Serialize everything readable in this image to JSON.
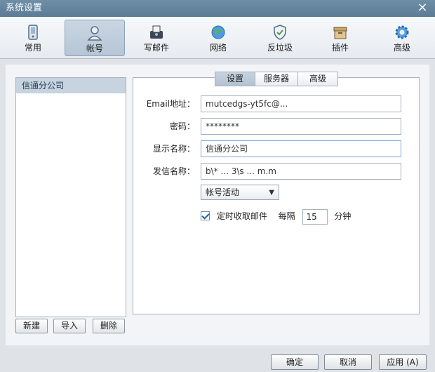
{
  "window": {
    "title": "系统设置",
    "close_icon": "close-icon"
  },
  "toolbar": {
    "items": [
      {
        "label": "常用",
        "icon": "phone-icon"
      },
      {
        "label": "帐号",
        "icon": "user-icon"
      },
      {
        "label": "写邮件",
        "icon": "compose-icon"
      },
      {
        "label": "网络",
        "icon": "globe-icon"
      },
      {
        "label": "反垃圾",
        "icon": "shield-icon"
      },
      {
        "label": "插件",
        "icon": "box-icon"
      },
      {
        "label": "高级",
        "icon": "gear-icon"
      }
    ],
    "active_index": 1
  },
  "accounts": {
    "items": [
      "信通分公司"
    ],
    "selected": "信通分公司"
  },
  "left_buttons": {
    "new": "新建",
    "import": "导入",
    "delete": "删除"
  },
  "tabs": [
    {
      "label": "设置"
    },
    {
      "label": "服务器"
    },
    {
      "label": "高级"
    }
  ],
  "form": {
    "email_label": "Email地址：",
    "email_value": "mutcedgs-yt5fc@...",
    "password_label": "密码：",
    "password_value": "********",
    "display_name_label": "显示名称：",
    "display_name_value": "信通分公司",
    "sender_name_label": "发信名称：",
    "sender_name_value": "b\\* ... 3\\s ... m.m",
    "account_status": "帐号活动",
    "auto_fetch_label": "定时收取邮件",
    "auto_fetch_checked": true,
    "interval_prefix": "每隔",
    "interval_value": "15",
    "interval_unit": "分钟"
  },
  "footer": {
    "ok": "确定",
    "cancel": "取消",
    "apply": "应用 (A)"
  },
  "colors": {
    "titlebar": "#5b7b96",
    "active_tab": "#b6c6d6",
    "check": "#1f5f9a"
  }
}
